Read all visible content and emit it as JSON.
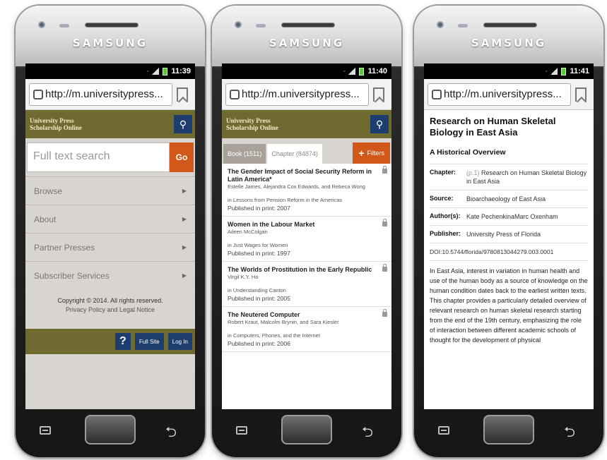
{
  "device": {
    "brand": "SAMSUNG"
  },
  "phones": [
    {
      "time": "11:39",
      "url": "http://m.universitypress...",
      "logo_line1": "University Press",
      "logo_line2": "Scholarship Online",
      "search_placeholder": "Full text search",
      "go_label": "Go",
      "nav": [
        "Browse",
        "About",
        "Partner Presses",
        "Subscriber Services"
      ],
      "copyright": "Copyright © 2014. All rights reserved.",
      "policy": "Privacy Policy and Legal Notice",
      "help_label": "?",
      "fullsite_label": "Full Site",
      "login_label": "Log In"
    },
    {
      "time": "11:40",
      "url": "http://m.universitypress...",
      "logo_line1": "University Press",
      "logo_line2": "Scholarship Online",
      "tab_book": "Book (1511)",
      "tab_chapter": "Chapter (84874)",
      "filters_label": "Filters",
      "results": [
        {
          "title": "The Gender Impact of Social Security Reform in Latin America*",
          "authors": "Estelle James, Alejandra Cox Edwards, and Rebeca Wong",
          "in": "in Lessons from Pension Reform in the Americas",
          "published": "Published in print: 2007"
        },
        {
          "title": "Women in the Labour Market",
          "authors": "Aileen McColgan",
          "in": "in Just Wages for Women",
          "published": "Published in print: 1997"
        },
        {
          "title": "The Worlds of Prostitution in the Early Republic",
          "authors": "Virgil K.Y. Ho",
          "in": "in Understanding Canton",
          "published": "Published in print: 2005"
        },
        {
          "title": "The Neutered Computer",
          "authors": "Robert Kraut, Malcolm Brynin, and Sara Kiesler",
          "in": "in Computers, Phones, and the Internet",
          "published": "Published in print: 2006"
        }
      ]
    },
    {
      "time": "11:41",
      "url": "http://m.universitypress...",
      "title": "Research on Human Skeletal Biology in East Asia",
      "subtitle": "A Historical Overview",
      "chapter_key": "Chapter:",
      "chapter_page": "(p.1)",
      "chapter_val": "Research on Human Skeletal Biology in East Asia",
      "source_key": "Source:",
      "source_val": "Bioarchaeology of East Asia",
      "author_key": "Author(s):",
      "author_val": "Kate PechenkinaMarc Oxenham",
      "publisher_key": "Publisher:",
      "publisher_val": "University Press of Florida",
      "doi": "DOI:10.5744/florida/9780813044279.003.0001",
      "abstract": "In East Asia, interest in variation in human health and use of the human body as a source of knowledge on the human condition dates back to the earliest written texts. This chapter provides a particularly detailed overview of relevant research on human skeletal research starting from the end of the 19th century, emphasizing the role of interaction between different academic schools of thought for the development of physical"
    }
  ]
}
